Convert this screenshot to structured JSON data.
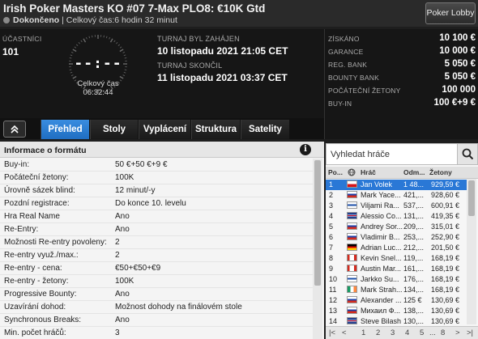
{
  "header": {
    "title": "Irish Poker Masters KO #07 7-Max PLO8: €10K Gtd",
    "status": "Dokončeno",
    "total_time": "| Celkový čas:6 hodin  32 minut",
    "lobby_button": "Poker Lobby"
  },
  "info": {
    "participants_label": "ÚČASTNÍCI",
    "participants_value": "101",
    "clock_digits": "--:--",
    "clock_label": "Celkový čas",
    "clock_value": "06:32:44",
    "started_label": "TURNAJ BYL ZAHÁJEN",
    "started_value": "10 listopadu 2021   21:05 CET",
    "ended_label": "TURNAJ SKONČIL",
    "ended_value": "11 listopadu 2021   03:37 CET"
  },
  "stats": [
    {
      "label": "ZÍSKÁNO",
      "value": "10 100 €"
    },
    {
      "label": "GARANCE",
      "value": "10 000 €"
    },
    {
      "label": "REG. BANK",
      "value": "5 050 €"
    },
    {
      "label": "BOUNTY BANK",
      "value": "5 050 €"
    },
    {
      "label": "POČÁTEČNÍ ŽETONY",
      "value": "100 000"
    },
    {
      "label": "BUY-IN",
      "value": "100 €+9 €"
    }
  ],
  "tabs": {
    "collapse_icon": "chevron-up-icon",
    "items": [
      "Přehled",
      "Stoly",
      "Vyplácení",
      "Struktura",
      "Satelity"
    ]
  },
  "format": {
    "title": "Informace o formátu",
    "rows": [
      {
        "k": "Buy-in:",
        "v": "50 €+50 €+9 €"
      },
      {
        "k": "Počáteční žetony:",
        "v": "100K"
      },
      {
        "k": "Úrovně sázek blind:",
        "v": "12 minut/-y"
      },
      {
        "k": "Pozdní registrace:",
        "v": "Do konce 10. levelu"
      },
      {
        "k": "Hra Real Name",
        "v": "Ano"
      },
      {
        "k": "Re-Entry:",
        "v": "Ano"
      },
      {
        "k": "Možnosti Re-entry povoleny:",
        "v": "2"
      },
      {
        "k": "Re-entry využ./max.:",
        "v": "2"
      },
      {
        "k": "Re-entry - cena:",
        "v": "€50+€50+€9"
      },
      {
        "k": "Re-entry - žetony:",
        "v": "100K"
      },
      {
        "k": "Progressive Bounty:",
        "v": "Ano"
      },
      {
        "k": "Uzavírání dohod:",
        "v": "Možnost dohody na finálovém stole"
      },
      {
        "k": "Synchronous Breaks:",
        "v": "Ano"
      },
      {
        "k": "Min. počet hráčů:",
        "v": "3"
      }
    ]
  },
  "players": {
    "search_placeholder": "Vyhledat hráče",
    "headers": [
      "Po...",
      "Hráč",
      "Odm...",
      "Žetony"
    ],
    "rows": [
      {
        "pos": "1",
        "name": "Jan Volek",
        "prize": "1 48...",
        "chips": "929,59 €",
        "flag": "cz"
      },
      {
        "pos": "2",
        "name": "Mark Yace...",
        "prize": "421,...",
        "chips": "928,60 €",
        "flag": "ru"
      },
      {
        "pos": "3",
        "name": "Viljami Ra...",
        "prize": "537,...",
        "chips": "600,91 €",
        "flag": "fi"
      },
      {
        "pos": "4",
        "name": "Alessio Co...",
        "prize": "131,...",
        "chips": "419,35 €",
        "flag": "gb"
      },
      {
        "pos": "5",
        "name": "Andrey Sor...",
        "prize": "209,...",
        "chips": "315,01 €",
        "flag": "ru"
      },
      {
        "pos": "6",
        "name": "Vladimir B...",
        "prize": "253,...",
        "chips": "252,90 €",
        "flag": "ru"
      },
      {
        "pos": "7",
        "name": "Adrian Luc...",
        "prize": "212,...",
        "chips": "201,50 €",
        "flag": "de"
      },
      {
        "pos": "8",
        "name": "Kevin Snel...",
        "prize": "119,...",
        "chips": "168,19 €",
        "flag": "ca"
      },
      {
        "pos": "9",
        "name": "Austin Mar...",
        "prize": "161,...",
        "chips": "168,19 €",
        "flag": "ca"
      },
      {
        "pos": "10",
        "name": "Jarkko Su...",
        "prize": "176,...",
        "chips": "168,19 €",
        "flag": "fi"
      },
      {
        "pos": "11",
        "name": "Mark Strah...",
        "prize": "134,...",
        "chips": "168,19 €",
        "flag": "ie"
      },
      {
        "pos": "12",
        "name": "Alexander ...",
        "prize": "125 €",
        "chips": "130,69 €",
        "flag": "ru"
      },
      {
        "pos": "13",
        "name": "Михаил Ф...",
        "prize": "138,...",
        "chips": "130,69 €",
        "flag": "ru"
      },
      {
        "pos": "14",
        "name": "Steve Bilash",
        "prize": "130,...",
        "chips": "130,69 €",
        "flag": "gb"
      }
    ],
    "pager": [
      "|<",
      "<",
      "1",
      "2",
      "3",
      "4",
      "5",
      "...",
      "8",
      ">",
      ">|"
    ]
  }
}
